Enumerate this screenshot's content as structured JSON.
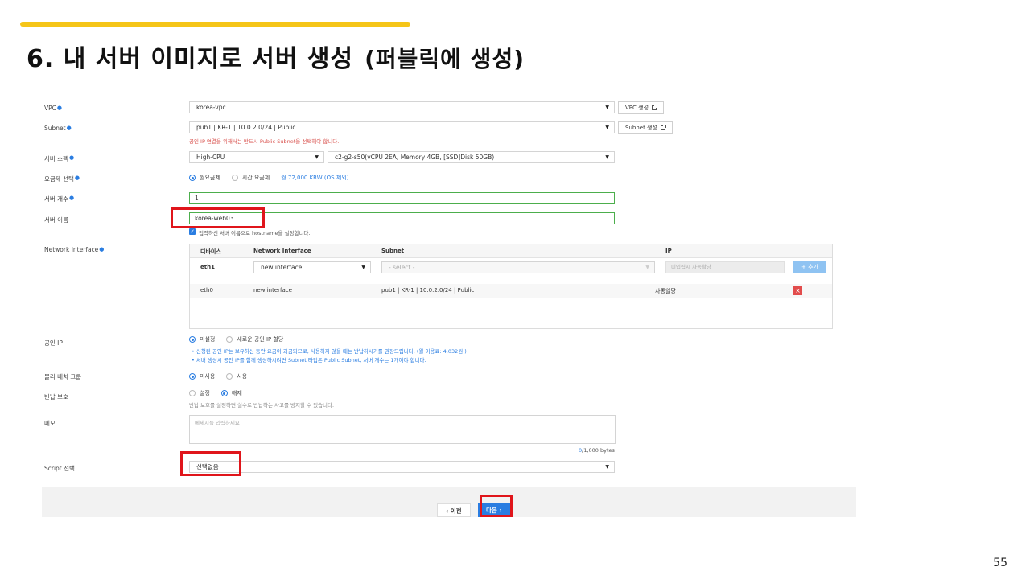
{
  "slide": {
    "title": "6. 내 서버 이미지로 서버 생성",
    "subtitle": "(퍼블릭에 생성)",
    "page_number": "55",
    "accent_color": "#f5c518",
    "highlight_color": "#e0151b"
  },
  "form": {
    "vpc": {
      "label": "VPC",
      "value": "korea-vpc",
      "button": "VPC 생성"
    },
    "subnet": {
      "label": "Subnet",
      "value": "pub1 | KR-1 | 10.0.2.0/24 | Public",
      "button": "Subnet 생성",
      "warning": "공인 IP 연결을 위해서는 반드시 Public Subnet을 선택해야 합니다."
    },
    "server_spec": {
      "label": "서버 스펙",
      "type": "High-CPU",
      "detail": "c2-g2-s50(vCPU 2EA, Memory 4GB, [SSD]Disk 50GB)"
    },
    "billing": {
      "label": "요금제 선택",
      "option_monthly": "월요금제",
      "option_hourly": "시간 요금제",
      "price": "월 72,000 KRW (OS 제외)"
    },
    "server_count": {
      "label": "서버 개수",
      "value": "1"
    },
    "server_name": {
      "label": "서버 이름",
      "value": "korea-web03",
      "hostname_note": "입력하신 서버 이름으로 hostname을 설정합니다."
    },
    "network_interface": {
      "label": "Network Interface",
      "headers": [
        "디바이스",
        "Network Interface",
        "Subnet",
        "IP"
      ],
      "add_row": {
        "device": "eth1",
        "interface": "new interface",
        "subnet_placeholder": "- select -",
        "ip_placeholder": "미입력시 자동할당",
        "add_button": "+ 추가"
      },
      "rows": [
        {
          "device": "eth0",
          "interface": "new interface",
          "subnet": "pub1 | KR-1 | 10.0.2.0/24 | Public",
          "ip": "자동할당"
        }
      ]
    },
    "public_ip": {
      "label": "공인 IP",
      "option_none": "미설정",
      "option_new": "새로운 공인 IP 할당",
      "note1": "• 신청된 공인 IP는 보유하신 동안 요금이 과금되므로, 사용하지 않을 때는 반납하시기를 권장드립니다. (월 이용료: 4,032원 )",
      "note2": "• 서버 생성시 공인 IP를 함께 생성하시려면 Subnet 타입은 Public Subnet, 서버 개수는 1개여야 합니다."
    },
    "placement_group": {
      "label": "물리 배치 그룹",
      "option_off": "미사용",
      "option_on": "사용"
    },
    "termination_protection": {
      "label": "반납 보호",
      "option_on": "설정",
      "option_off": "해제",
      "note": "반납 보호를 설정하면 실수로 반납하는 사고를 방지할 수 있습니다."
    },
    "memo": {
      "label": "메모",
      "placeholder": "메세지를 입력하세요",
      "used": "0",
      "limit": "/1,000 bytes"
    },
    "script": {
      "label": "Script 선택",
      "value": "선택없음"
    }
  },
  "footer": {
    "prev_label": "이전",
    "next_label": "다음"
  }
}
